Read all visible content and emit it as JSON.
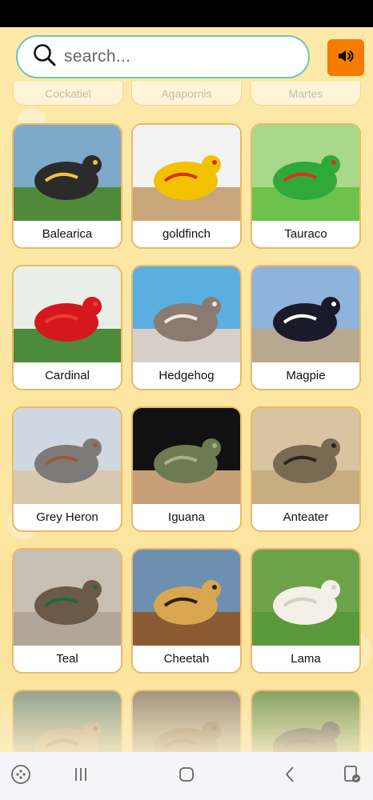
{
  "search": {
    "placeholder": "search..."
  },
  "previous_row": [
    "Cockatiel",
    "Agapornis",
    "Martes"
  ],
  "animals": [
    {
      "label": "Balearica",
      "sky": "#7fa9c9",
      "ground": "#4f8a3a",
      "body": "#2b2b2b",
      "accent": "#f0c040"
    },
    {
      "label": "goldfinch",
      "sky": "#f2f2f2",
      "ground": "#c8a57a",
      "body": "#f2c200",
      "accent": "#d63020"
    },
    {
      "label": "Tauraco",
      "sky": "#a8d88a",
      "ground": "#6cc24a",
      "body": "#2faa3a",
      "accent": "#e03020"
    },
    {
      "label": "Cardinal",
      "sky": "#e9efe6",
      "ground": "#4c8b3a",
      "body": "#d5171e",
      "accent": "#e84030"
    },
    {
      "label": "Hedgehog",
      "sky": "#5aaee0",
      "ground": "#d8d0c8",
      "body": "#8a7a70",
      "accent": "#f0e6dc"
    },
    {
      "label": "Magpie",
      "sky": "#8fb4dc",
      "ground": "#b8a890",
      "body": "#1a1a2a",
      "accent": "#ffffff"
    },
    {
      "label": "Grey Heron",
      "sky": "#cfd8e2",
      "ground": "#d8c8b0",
      "body": "#7d7a78",
      "accent": "#9b5a3a"
    },
    {
      "label": "Iguana",
      "sky": "#111111",
      "ground": "#c8a078",
      "body": "#6d7a52",
      "accent": "#a8b088"
    },
    {
      "label": "Anteater",
      "sky": "#d8c4a0",
      "ground": "#c8ad80",
      "body": "#7a6a54",
      "accent": "#2a2420"
    },
    {
      "label": "Teal",
      "sky": "#c7bfb3",
      "ground": "#b0a69a",
      "body": "#6b5a48",
      "accent": "#1d6b3a"
    },
    {
      "label": "Cheetah",
      "sky": "#6d8fb0",
      "ground": "#8a5a34",
      "body": "#d9a650",
      "accent": "#2a2018"
    },
    {
      "label": "Lama",
      "sky": "#6ea24a",
      "ground": "#5a9a3a",
      "body": "#f4f0e8",
      "accent": "#d8cfc0"
    },
    {
      "label": "",
      "sky": "#8a9a8a",
      "ground": "#5a7a6a",
      "body": "#b89a80",
      "accent": "#8a7060"
    },
    {
      "label": "",
      "sky": "#9a8a7a",
      "ground": "#7a6a5a",
      "body": "#8a7060",
      "accent": "#6a5a4a"
    },
    {
      "label": "",
      "sky": "#7a9a5a",
      "ground": "#6a8a4a",
      "body": "#4a4a4a",
      "accent": "#3a3a3a"
    }
  ],
  "colors": {
    "accent": "#f57c00",
    "card_border": "#ebb968",
    "search_border": "#6cc7b8"
  }
}
